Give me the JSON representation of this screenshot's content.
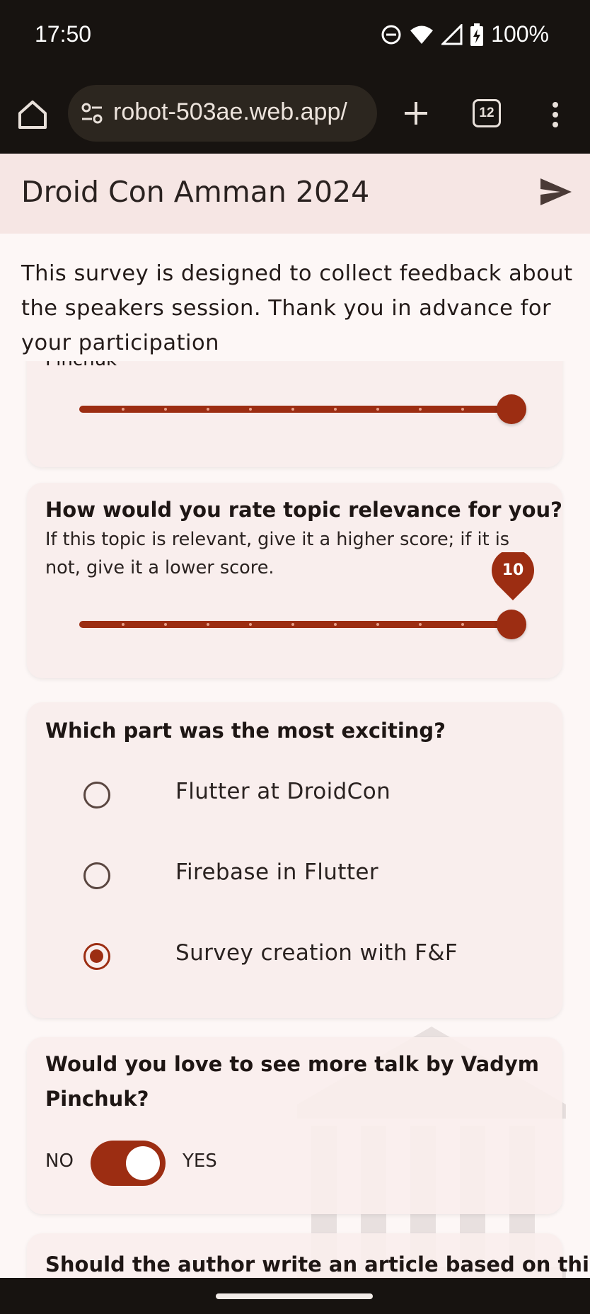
{
  "status_bar": {
    "time": "17:50",
    "battery_text": "100%",
    "icons": [
      "do-not-disturb-icon",
      "wifi-icon",
      "signal-icon",
      "battery-charging-icon"
    ]
  },
  "browser": {
    "url": "robot-503ae.web.app/",
    "tab_count": "12",
    "icons": [
      "home-icon",
      "site-settings-icon",
      "new-tab-icon",
      "tabs-icon",
      "more-menu-icon"
    ]
  },
  "app": {
    "title": "Droid Con Amman 2024",
    "send_icon": "send-icon",
    "accent_color": "#9c2d12",
    "intro": "This survey is designed to collect feedback about the speakers session. Thank you in advance for your participation"
  },
  "cards": {
    "partial_card": {
      "title_fragment": "Pinchuk",
      "slider_value": 10,
      "slider_min": 0,
      "slider_max": 10
    },
    "relevance": {
      "title": "How would you rate topic relevance for you?",
      "subtitle": "If this topic is relevant, give it a higher score; if it is not, give it a lower score.",
      "slider_value": 10,
      "slider_value_label": "10",
      "slider_min": 0,
      "slider_max": 10
    },
    "exciting": {
      "title": "Which part was the most exciting?",
      "options": [
        {
          "label": "Flutter at DroidCon",
          "selected": false
        },
        {
          "label": "Firebase in Flutter",
          "selected": false
        },
        {
          "label": "Survey creation with F&F",
          "selected": true
        }
      ]
    },
    "more_talk": {
      "title": "Would you love to see more talk by Vadym Pinchuk?",
      "no_label": "NO",
      "yes_label": "YES",
      "value": true
    },
    "article": {
      "title": "Should the author write an article based on this"
    }
  }
}
